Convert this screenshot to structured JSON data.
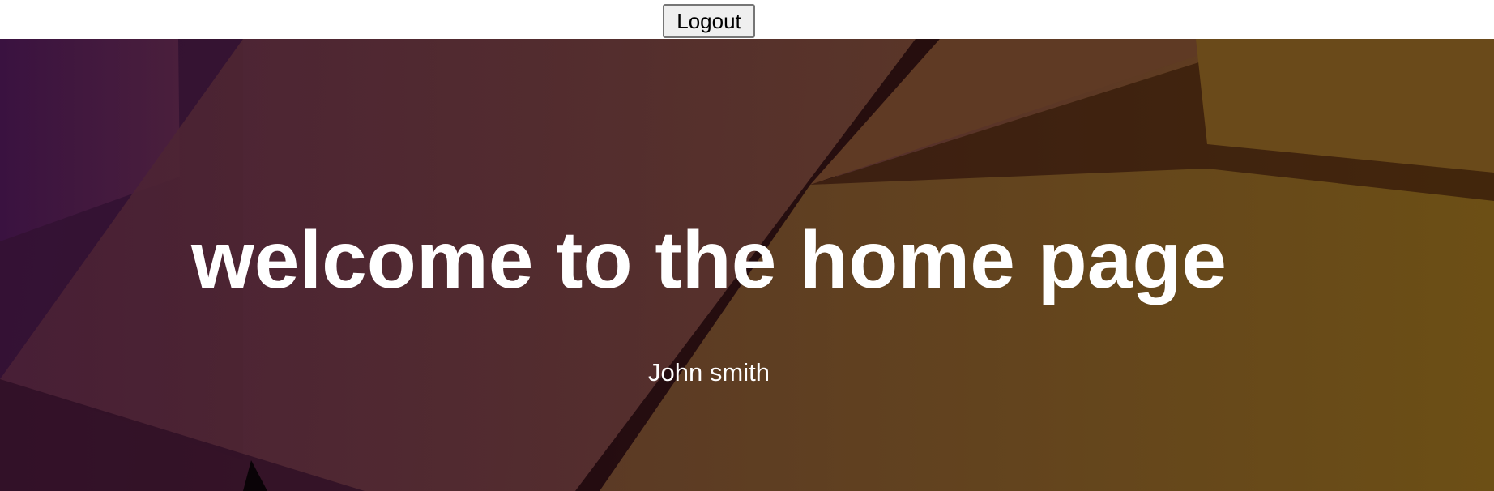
{
  "header": {
    "logout_label": "Logout"
  },
  "hero": {
    "title": "welcome to the home page",
    "user_name": "John smith"
  },
  "colors": {
    "hero_left": "#3f1747",
    "hero_right": "#6b4d14",
    "text": "#ffffff"
  }
}
